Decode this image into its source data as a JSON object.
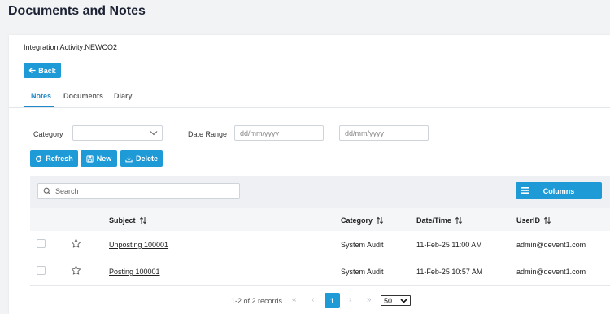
{
  "page": {
    "title": "Documents and Notes"
  },
  "context": {
    "label": "Integration Activity:NEWCO2"
  },
  "back_button": {
    "label": "Back"
  },
  "tabs": [
    {
      "label": "Notes",
      "active": true
    },
    {
      "label": "Documents",
      "active": false
    },
    {
      "label": "Diary",
      "active": false
    }
  ],
  "filters": {
    "category_label": "Category",
    "category_value": "",
    "date_range_label": "Date Range",
    "date_from_placeholder": "dd/mm/yyyy",
    "date_to_placeholder": "dd/mm/yyyy"
  },
  "actions": {
    "refresh": "Refresh",
    "new": "New",
    "delete": "Delete"
  },
  "grid": {
    "search_placeholder": "Search",
    "columns_button": "Columns",
    "headers": {
      "subject": "Subject",
      "category": "Category",
      "datetime": "Date/Time",
      "userid": "UserID"
    },
    "rows": [
      {
        "subject": "Unposting 100001",
        "category": "System Audit",
        "datetime": "11-Feb-25 11:00 AM",
        "userid": "admin@devent1.com",
        "checked": false,
        "starred": false
      },
      {
        "subject": "Posting 100001",
        "category": "System Audit",
        "datetime": "11-Feb-25 10:57 AM",
        "userid": "admin@devent1.com",
        "checked": false,
        "starred": false
      }
    ]
  },
  "pagination": {
    "info": "1-2 of 2 records",
    "first": "«",
    "prev": "‹",
    "current_page": "1",
    "next": "›",
    "last": "»",
    "page_size": "50"
  },
  "colors": {
    "accent": "#1e9bd7",
    "tab_active": "#1e88c8"
  }
}
